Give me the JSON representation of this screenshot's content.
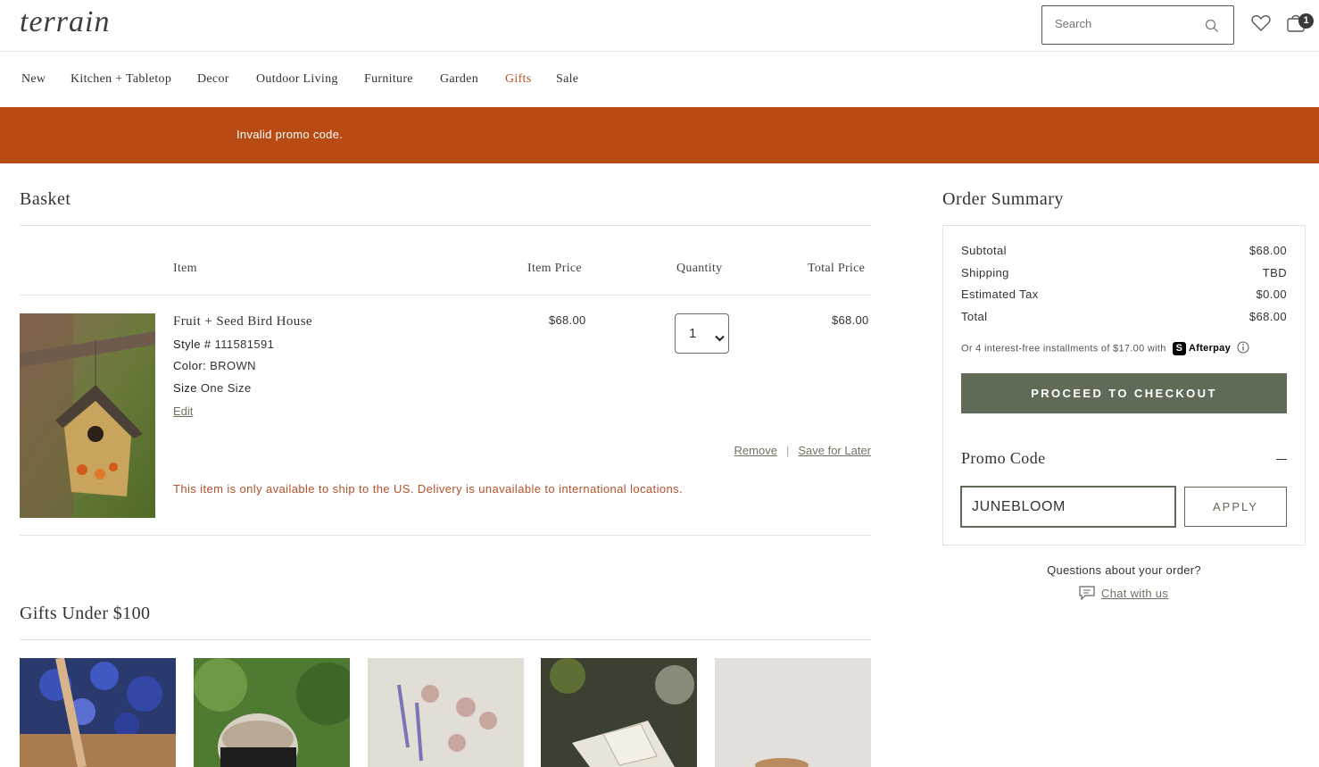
{
  "header": {
    "logo": "terrain",
    "search_placeholder": "Search",
    "cart_count": "1"
  },
  "nav": {
    "items": [
      "New",
      "Kitchen + Tabletop",
      "Decor",
      "Outdoor Living",
      "Furniture",
      "Garden",
      "Gifts",
      "Sale"
    ],
    "active": "Gifts"
  },
  "banner": {
    "message": "Invalid promo code."
  },
  "basket": {
    "title": "Basket",
    "columns": {
      "item": "Item",
      "item_price": "Item Price",
      "quantity": "Quantity",
      "total_price": "Total Price"
    },
    "product": {
      "name": "Fruit + Seed Bird House",
      "style_label": "Style #",
      "style_value": "111581591",
      "color_label": "Color:",
      "color_value": "BROWN",
      "size_label": "Size",
      "size_value": "One Size",
      "edit": "Edit",
      "item_price": "$68.00",
      "quantity": "1",
      "total_price": "$68.00",
      "remove": "Remove",
      "separator": "|",
      "save_for_later": "Save for Later",
      "shipping_warning": "This item is only available to ship to the US. Delivery is unavailable to international locations."
    }
  },
  "recommendations": {
    "title": "Gifts Under $100"
  },
  "summary": {
    "title": "Order Summary",
    "rows": [
      {
        "label": "Subtotal",
        "value": "$68.00"
      },
      {
        "label": "Shipping",
        "value": "TBD"
      },
      {
        "label": "Estimated Tax",
        "value": "$0.00"
      },
      {
        "label": "Total",
        "value": "$68.00"
      }
    ],
    "afterpay_text": "Or 4 interest-free installments of $17.00 with",
    "afterpay_logo": "S",
    "afterpay_name": "Afterpay",
    "checkout": "PROCEED TO CHECKOUT",
    "promo_title": "Promo Code",
    "promo_value": "JUNEBLOOM",
    "apply": "APPLY",
    "questions": "Questions about your order?",
    "chat": "Chat with us"
  },
  "colors": {
    "accent": "#b84b14",
    "primary_button": "#5f6b57",
    "link": "#6d7560",
    "warning_text": "#b5512a"
  }
}
